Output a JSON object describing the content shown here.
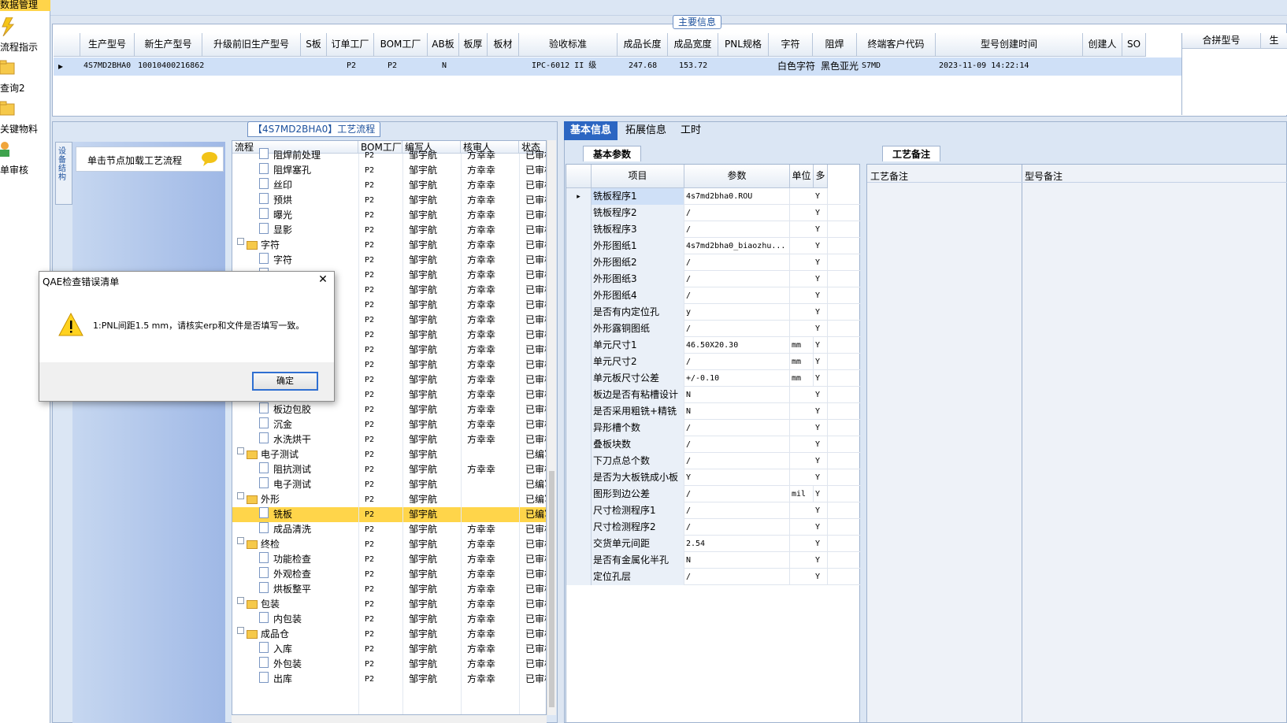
{
  "left_nav": {
    "header": "数据管理",
    "items": [
      {
        "label": "流程指示",
        "icon": "lightning-icon"
      },
      {
        "label": "查询2",
        "icon": "folder-icon"
      },
      {
        "label": "关键物料",
        "icon": "folder-icon"
      },
      {
        "label": "单审核",
        "icon": "user-icon"
      }
    ]
  },
  "main_info": {
    "title": "主要信息",
    "columns": [
      "生产型号",
      "新生产型号",
      "升级前旧生产型号",
      "S板",
      "订单工厂",
      "BOM工厂",
      "AB板",
      "板厚",
      "板材",
      "验收标准",
      "成品长度",
      "成品宽度",
      "PNL规格",
      "字符",
      "阻焊",
      "终端客户代码",
      "型号创建时间",
      "创建人",
      "SO"
    ],
    "row": {
      "生产型号": "4S7MD2BHA0",
      "新生产型号": "10010400216862",
      "订单工厂": "P2",
      "BOM工厂": "P2",
      "AB板": "N",
      "验收标准": "IPC-6012 II 级",
      "成品长度": "247.68",
      "成品宽度": "153.72",
      "字符": "白色字符",
      "阻焊": "黑色亚光",
      "终端客户代码": "S7MD",
      "型号创建时间": "2023-11-09 14:22:14"
    },
    "side_columns": [
      "合拼型号",
      "生"
    ]
  },
  "flow_panel": {
    "title": "【4S7MD2BHA0】工艺流程",
    "side_tab": "设备结构",
    "node_hint": "单击节点加载工艺流程",
    "columns": [
      "流程",
      "BOM工厂",
      "编写人",
      "核审人",
      "状态"
    ],
    "rows": [
      {
        "name": "阻焊前处理",
        "level": 2,
        "type": "file",
        "bom": "P2",
        "writer": "邹宇航",
        "reviewer": "方幸幸",
        "status": "已审核"
      },
      {
        "name": "阻焊塞孔",
        "level": 2,
        "type": "file",
        "bom": "P2",
        "writer": "邹宇航",
        "reviewer": "方幸幸",
        "status": "已审核"
      },
      {
        "name": "丝印",
        "level": 2,
        "type": "file",
        "bom": "P2",
        "writer": "邹宇航",
        "reviewer": "方幸幸",
        "status": "已审核"
      },
      {
        "name": "预烘",
        "level": 2,
        "type": "file",
        "bom": "P2",
        "writer": "邹宇航",
        "reviewer": "方幸幸",
        "status": "已审核"
      },
      {
        "name": "曝光",
        "level": 2,
        "type": "file",
        "bom": "P2",
        "writer": "邹宇航",
        "reviewer": "方幸幸",
        "status": "已审核"
      },
      {
        "name": "显影",
        "level": 2,
        "type": "file",
        "bom": "P2",
        "writer": "邹宇航",
        "reviewer": "方幸幸",
        "status": "已审核"
      },
      {
        "name": "字符",
        "level": 1,
        "type": "folder",
        "bom": "P2",
        "writer": "邹宇航",
        "reviewer": "方幸幸",
        "status": "已审核"
      },
      {
        "name": "字符",
        "level": 2,
        "type": "file",
        "bom": "P2",
        "writer": "邹宇航",
        "reviewer": "方幸幸",
        "status": "已审核"
      },
      {
        "name": "",
        "level": 2,
        "type": "file",
        "bom": "P2",
        "writer": "邹宇航",
        "reviewer": "方幸幸",
        "status": "已审核"
      },
      {
        "name": "",
        "level": 2,
        "type": "file",
        "bom": "P2",
        "writer": "邹宇航",
        "reviewer": "方幸幸",
        "status": "已审核"
      },
      {
        "name": "",
        "level": 2,
        "type": "file",
        "bom": "P2",
        "writer": "邹宇航",
        "reviewer": "方幸幸",
        "status": "已审核"
      },
      {
        "name": "",
        "level": 2,
        "type": "file",
        "bom": "P2",
        "writer": "邹宇航",
        "reviewer": "方幸幸",
        "status": "已审核"
      },
      {
        "name": "",
        "level": 2,
        "type": "file",
        "bom": "P2",
        "writer": "邹宇航",
        "reviewer": "方幸幸",
        "status": "已审核"
      },
      {
        "name": "",
        "level": 2,
        "type": "file",
        "bom": "P2",
        "writer": "邹宇航",
        "reviewer": "方幸幸",
        "status": "已审核"
      },
      {
        "name": "",
        "level": 2,
        "type": "file",
        "bom": "P2",
        "writer": "邹宇航",
        "reviewer": "方幸幸",
        "status": "已审核"
      },
      {
        "name": "",
        "level": 2,
        "type": "file",
        "bom": "P2",
        "writer": "邹宇航",
        "reviewer": "方幸幸",
        "status": "已审核"
      },
      {
        "name": "",
        "level": 2,
        "type": "file",
        "bom": "P2",
        "writer": "邹宇航",
        "reviewer": "方幸幸",
        "status": "已审核"
      },
      {
        "name": "板边包胶",
        "level": 2,
        "type": "file",
        "bom": "P2",
        "writer": "邹宇航",
        "reviewer": "方幸幸",
        "status": "已审核"
      },
      {
        "name": "沉金",
        "level": 2,
        "type": "file",
        "bom": "P2",
        "writer": "邹宇航",
        "reviewer": "方幸幸",
        "status": "已审核"
      },
      {
        "name": "水洗烘干",
        "level": 2,
        "type": "file",
        "bom": "P2",
        "writer": "邹宇航",
        "reviewer": "方幸幸",
        "status": "已审核"
      },
      {
        "name": "电子测试",
        "level": 1,
        "type": "folder",
        "bom": "P2",
        "writer": "邹宇航",
        "reviewer": "",
        "status": "已编写"
      },
      {
        "name": "阻抗测试",
        "level": 2,
        "type": "file",
        "bom": "P2",
        "writer": "邹宇航",
        "reviewer": "方幸幸",
        "status": "已审核"
      },
      {
        "name": "电子测试",
        "level": 2,
        "type": "file",
        "bom": "P2",
        "writer": "邹宇航",
        "reviewer": "",
        "status": "已编写"
      },
      {
        "name": "外形",
        "level": 1,
        "type": "folder",
        "bom": "P2",
        "writer": "邹宇航",
        "reviewer": "",
        "status": "已编写"
      },
      {
        "name": "铣板",
        "level": 2,
        "type": "file",
        "bom": "P2",
        "writer": "邹宇航",
        "reviewer": "",
        "status": "已编写",
        "selected": true
      },
      {
        "name": "成品清洗",
        "level": 2,
        "type": "file",
        "bom": "P2",
        "writer": "邹宇航",
        "reviewer": "方幸幸",
        "status": "已审核"
      },
      {
        "name": "终检",
        "level": 1,
        "type": "folder",
        "bom": "P2",
        "writer": "邹宇航",
        "reviewer": "方幸幸",
        "status": "已审核"
      },
      {
        "name": "功能检查",
        "level": 2,
        "type": "file",
        "bom": "P2",
        "writer": "邹宇航",
        "reviewer": "方幸幸",
        "status": "已审核"
      },
      {
        "name": "外观检查",
        "level": 2,
        "type": "file",
        "bom": "P2",
        "writer": "邹宇航",
        "reviewer": "方幸幸",
        "status": "已审核"
      },
      {
        "name": "烘板整平",
        "level": 2,
        "type": "file",
        "bom": "P2",
        "writer": "邹宇航",
        "reviewer": "方幸幸",
        "status": "已审核"
      },
      {
        "name": "包装",
        "level": 1,
        "type": "folder",
        "bom": "P2",
        "writer": "邹宇航",
        "reviewer": "方幸幸",
        "status": "已审核"
      },
      {
        "name": "内包装",
        "level": 2,
        "type": "file",
        "bom": "P2",
        "writer": "邹宇航",
        "reviewer": "方幸幸",
        "status": "已审核"
      },
      {
        "name": "成品仓",
        "level": 1,
        "type": "folder",
        "bom": "P2",
        "writer": "邹宇航",
        "reviewer": "方幸幸",
        "status": "已审核"
      },
      {
        "name": "入库",
        "level": 2,
        "type": "file",
        "bom": "P2",
        "writer": "邹宇航",
        "reviewer": "方幸幸",
        "status": "已审核"
      },
      {
        "name": "外包装",
        "level": 2,
        "type": "file",
        "bom": "P2",
        "writer": "邹宇航",
        "reviewer": "方幸幸",
        "status": "已审核"
      },
      {
        "name": "出库",
        "level": 2,
        "type": "file",
        "bom": "P2",
        "writer": "邹宇航",
        "reviewer": "方幸幸",
        "status": "已审核"
      }
    ]
  },
  "right_tabs": [
    "基本信息",
    "拓展信息",
    "工时"
  ],
  "basic_params": {
    "tab": "基本参数",
    "columns": [
      "项目",
      "参数",
      "单位",
      "多"
    ],
    "rows": [
      {
        "item": "铣板程序1",
        "param": "4s7md2bha0.ROU",
        "unit": "",
        "flag": "Y"
      },
      {
        "item": "铣板程序2",
        "param": "/",
        "unit": "",
        "flag": "Y"
      },
      {
        "item": "铣板程序3",
        "param": "/",
        "unit": "",
        "flag": "Y"
      },
      {
        "item": "外形图纸1",
        "param": "4s7md2bha0_biaozhu...",
        "unit": "",
        "flag": "Y"
      },
      {
        "item": "外形图纸2",
        "param": "/",
        "unit": "",
        "flag": "Y"
      },
      {
        "item": "外形图纸3",
        "param": "/",
        "unit": "",
        "flag": "Y"
      },
      {
        "item": "外形图纸4",
        "param": "/",
        "unit": "",
        "flag": "Y"
      },
      {
        "item": "是否有内定位孔",
        "param": "y",
        "unit": "",
        "flag": "Y"
      },
      {
        "item": "外形露铜图纸",
        "param": "/",
        "unit": "",
        "flag": "Y"
      },
      {
        "item": "单元尺寸1",
        "param": "46.50X20.30",
        "unit": "mm",
        "flag": "Y"
      },
      {
        "item": "单元尺寸2",
        "param": "/",
        "unit": "mm",
        "flag": "Y"
      },
      {
        "item": "单元板尺寸公差",
        "param": "+/-0.10",
        "unit": "mm",
        "flag": "Y"
      },
      {
        "item": "板边是否有粘槽设计",
        "param": "N",
        "unit": "",
        "flag": "Y"
      },
      {
        "item": "是否采用粗铣+精铣",
        "param": "N",
        "unit": "",
        "flag": "Y"
      },
      {
        "item": "异形槽个数",
        "param": "/",
        "unit": "",
        "flag": "Y"
      },
      {
        "item": "叠板块数",
        "param": "/",
        "unit": "",
        "flag": "Y"
      },
      {
        "item": "下刀点总个数",
        "param": "/",
        "unit": "",
        "flag": "Y"
      },
      {
        "item": "是否为大板铣成小板",
        "param": "Y",
        "unit": "",
        "flag": "Y"
      },
      {
        "item": "图形到边公差",
        "param": "/",
        "unit": "mil",
        "flag": "Y"
      },
      {
        "item": "尺寸检测程序1",
        "param": "/",
        "unit": "",
        "flag": "Y"
      },
      {
        "item": "尺寸检测程序2",
        "param": "/",
        "unit": "",
        "flag": "Y"
      },
      {
        "item": "交货单元间距",
        "param": "2.54",
        "unit": "",
        "flag": "Y"
      },
      {
        "item": "是否有金属化半孔",
        "param": "N",
        "unit": "",
        "flag": "Y"
      },
      {
        "item": "定位孔层",
        "param": "/",
        "unit": "",
        "flag": "Y"
      }
    ]
  },
  "process_remarks": {
    "tab": "工艺备注",
    "col1": "工艺备注",
    "col2": "型号备注"
  },
  "dialog": {
    "title": "QAE检查错误清单",
    "message": "1:PNL间距1.5 mm，请核实erp和文件是否填写一致。",
    "ok_label": "确定",
    "close_symbol": "✕"
  }
}
